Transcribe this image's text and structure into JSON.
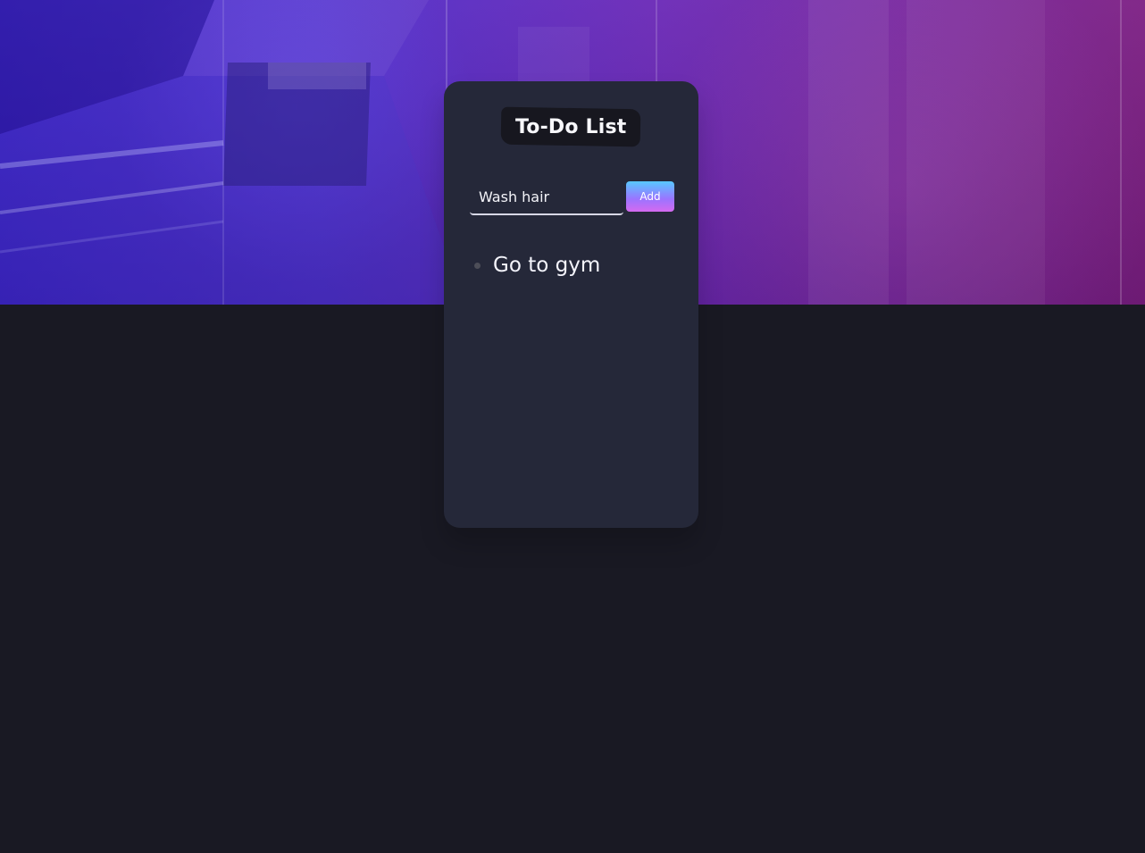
{
  "colors": {
    "page_background": "#191923",
    "card_background": "#252839",
    "title_background": "#17171f",
    "text": "#f4f4fb",
    "button_gradient_start": "#58c8ff",
    "button_gradient_end": "#d56af0"
  },
  "todo_app": {
    "title": "To-Do List",
    "input_value": "Wash hair",
    "add_label": "Add",
    "items": [
      {
        "label": "Go to gym",
        "bullet_icon": "bullet-icon"
      }
    ]
  }
}
